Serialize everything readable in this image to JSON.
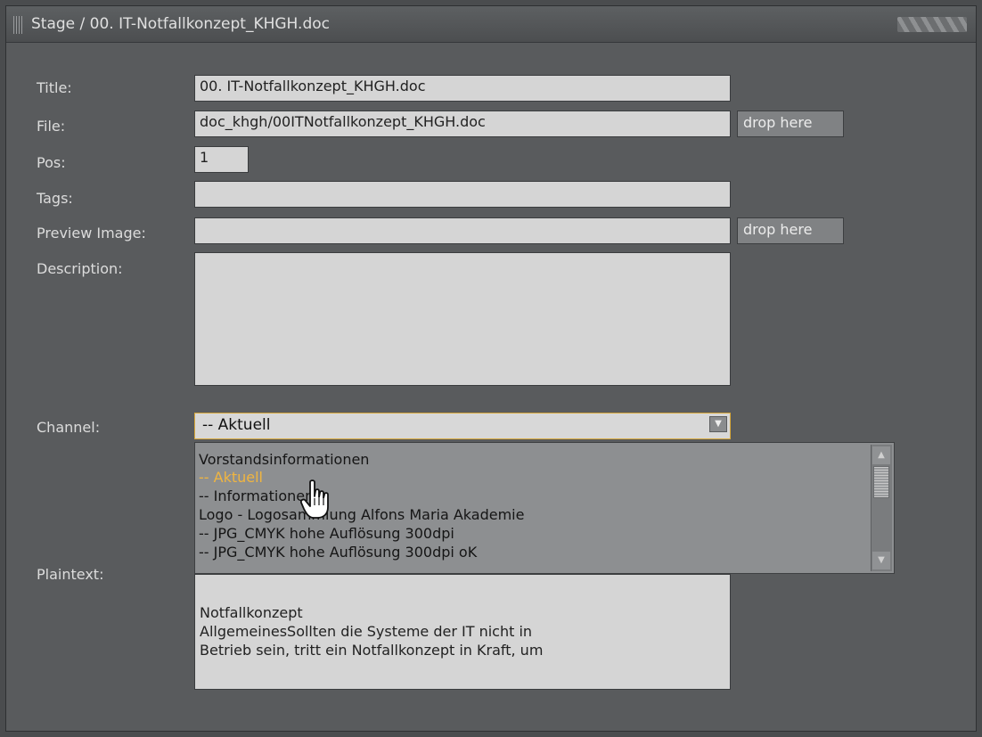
{
  "window": {
    "title": "Stage / 00. IT-Notfallkonzept_KHGH.doc"
  },
  "form": {
    "title_label": "Title:",
    "title_value": "00. IT-Notfallkonzept_KHGH.doc",
    "file_label": "File:",
    "file_value": "doc_khgh/00ITNotfallkonzept_KHGH.doc",
    "file_drop": "drop here",
    "pos_label": "Pos:",
    "pos_value": "1",
    "tags_label": "Tags:",
    "tags_value": "",
    "preview_label": "Preview Image:",
    "preview_value": "",
    "preview_drop": "drop here",
    "description_label": "Description:",
    "description_value": "",
    "channel_label": "Channel:",
    "channel_value": "-- Aktuell",
    "plaintext_label": "Plaintext:",
    "plaintext_lines": [
      "Notfallkonzept",
      "AllgemeinesSollten die Systeme der IT nicht in",
      "Betrieb sein, tritt ein Notfallkonzept in Kraft, um"
    ]
  },
  "channel_options": [
    "Vorstandsinformationen",
    "-- Aktuell",
    "-- Informationen",
    "Logo - Logosammlung Alfons Maria Akademie",
    "-- JPG_CMYK hohe Auflösung 300dpi",
    "-- JPG_CMYK hohe Auflösung 300dpi oK"
  ],
  "channel_hovered_index": 1,
  "icons": {
    "scroll_up": "chevron-up-icon",
    "scroll_down": "chevron-down-icon",
    "select_arrow": "triangle-down-icon",
    "cursor": "hand-pointer-icon"
  },
  "colors": {
    "background": "#595b5d",
    "field": "#d5d5d5",
    "highlight": "#f0b540",
    "label": "#dcdcdc"
  }
}
